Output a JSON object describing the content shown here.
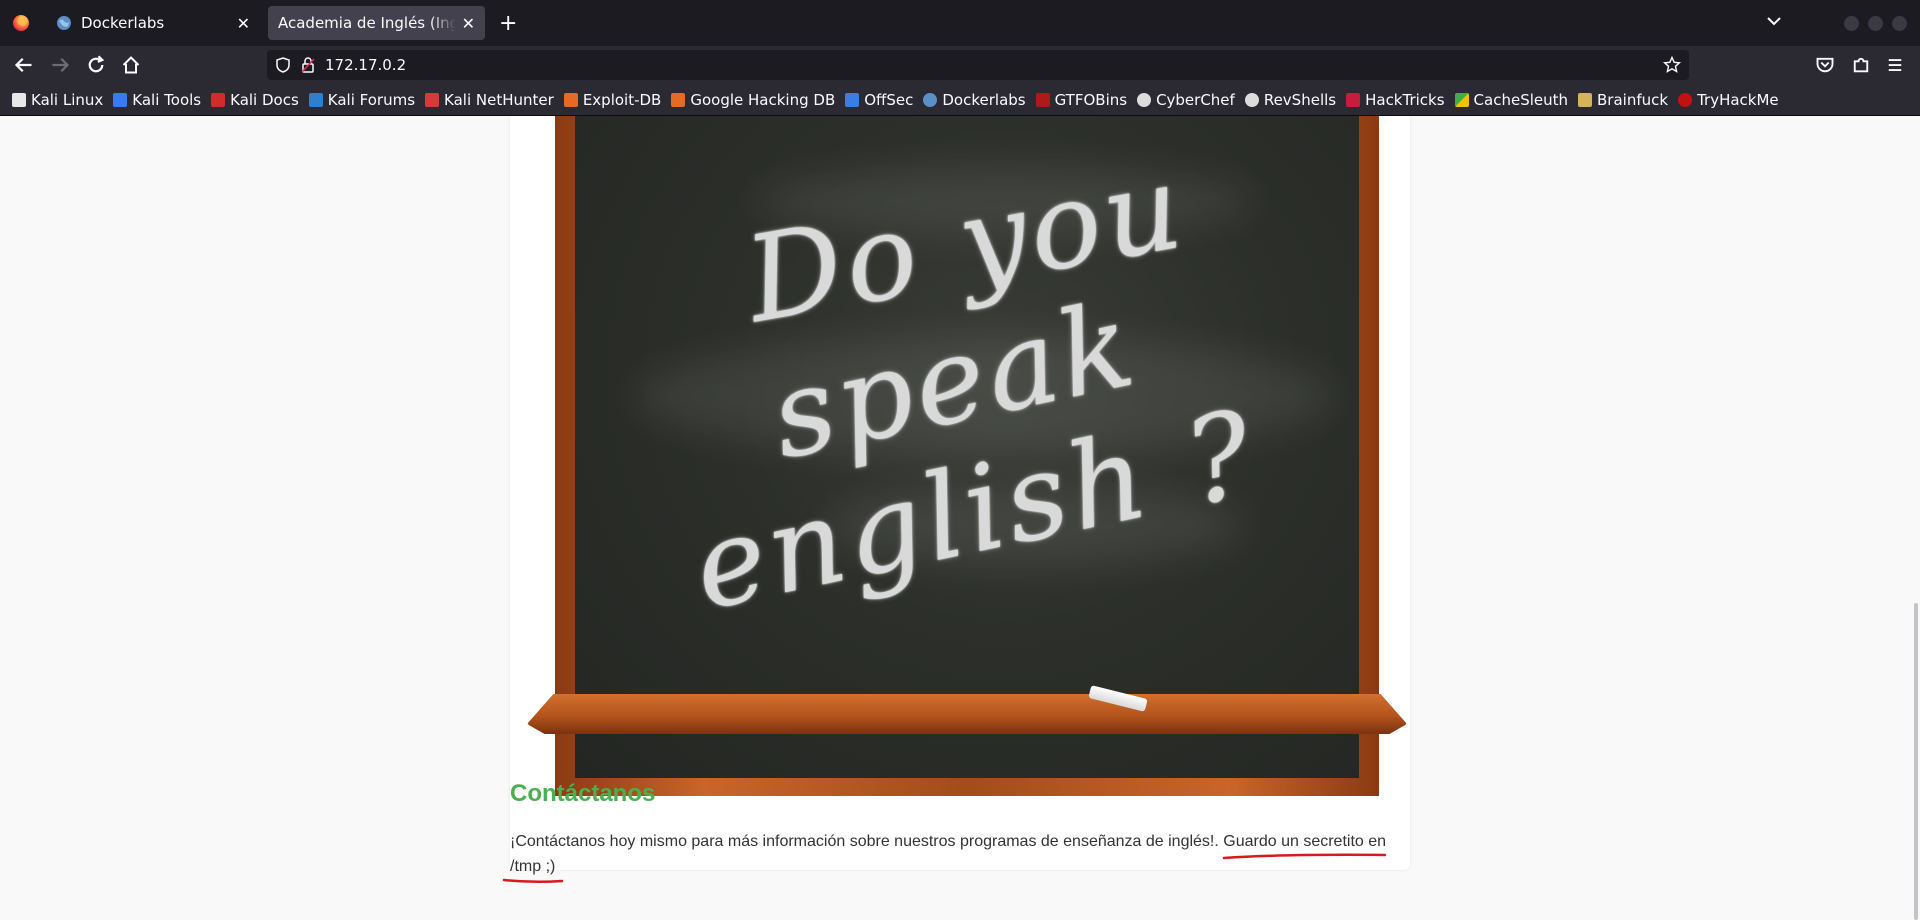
{
  "browser": {
    "tabs": [
      {
        "title": "Dockerlabs",
        "favicon": "globe-icon",
        "active": false
      },
      {
        "title": "Academia de Inglés (Inglis Academi)",
        "favicon": "",
        "active": true
      }
    ],
    "url": "172.17.0.2",
    "bookmarks": [
      {
        "label": "Kali Linux",
        "icon": "kali-dragon-icon",
        "color": "#e8e8e8"
      },
      {
        "label": "Kali Tools",
        "icon": "kali-tools-icon",
        "color": "#367bf0"
      },
      {
        "label": "Kali Docs",
        "icon": "kali-docs-icon",
        "color": "#d12b2b"
      },
      {
        "label": "Kali Forums",
        "icon": "kali-forums-icon",
        "color": "#2f7fd0"
      },
      {
        "label": "Kali NetHunter",
        "icon": "nethunter-icon",
        "color": "#d63a3a"
      },
      {
        "label": "Exploit-DB",
        "icon": "exploit-db-icon",
        "color": "#e56a23"
      },
      {
        "label": "Google Hacking DB",
        "icon": "ghdb-icon",
        "color": "#e56a23"
      },
      {
        "label": "OffSec",
        "icon": "offsec-icon",
        "color": "#3b7de0"
      },
      {
        "label": "Dockerlabs",
        "icon": "globe-icon",
        "color": "#5b8fc7"
      },
      {
        "label": "GTFOBins",
        "icon": "gtfobins-icon",
        "color": "#b01919"
      },
      {
        "label": "CyberChef",
        "icon": "chef-icon",
        "color": "#dcdcdc"
      },
      {
        "label": "RevShells",
        "icon": "skull-icon",
        "color": "#dcdcdc"
      },
      {
        "label": "HackTricks",
        "icon": "hacktricks-icon",
        "color": "#c81c3c"
      },
      {
        "label": "CacheSleuth",
        "icon": "cachesleuth-icon",
        "color": "#3fae49"
      },
      {
        "label": "Brainfuck",
        "icon": "brainfuck-icon",
        "color": "#d6b25c"
      },
      {
        "label": "TryHackMe",
        "icon": "tryhackme-icon",
        "color": "#c11111"
      }
    ]
  },
  "page": {
    "image_text": [
      "Do you",
      "speak",
      "english ?"
    ],
    "contact_title": "Contáctanos",
    "contact_text": "¡Contáctanos hoy mismo para más información sobre nuestros programas de enseñanza de inglés!. Guardo un secretito en /tmp ;)"
  },
  "colors": {
    "heading_green": "#4caf50",
    "annotation_red": "#d71920"
  }
}
